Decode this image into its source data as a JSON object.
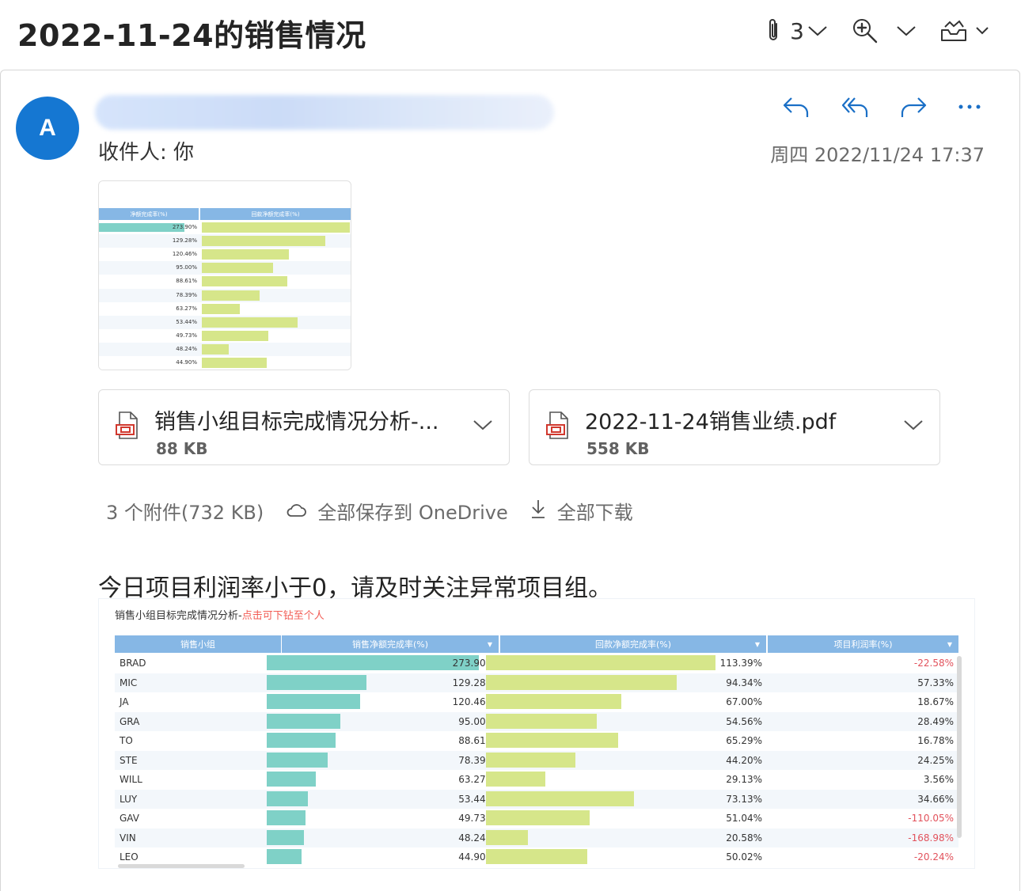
{
  "subject": "2022-11-24的销售情况",
  "top_actions": {
    "attachment_count": "3"
  },
  "message": {
    "avatar_letter": "A",
    "recipient": "收件人: 你",
    "datetime": "周四 2022/11/24 17:37",
    "body_text": "今日项目利润率小于0，请及时关注异常项目组。"
  },
  "attachments": [
    {
      "name": "销售小组目标完成情况分析-...",
      "size": "88 KB"
    },
    {
      "name": "2022-11-24销售业绩.pdf",
      "size": "558 KB"
    }
  ],
  "attachment_summary": {
    "count_label": "3 个附件(732 KB)",
    "save_label": "全部保存到 OneDrive",
    "download_label": "全部下载"
  },
  "thumbnail": {
    "headers": [
      "净额完成率(%)",
      "回款净额完成率(%)"
    ]
  },
  "colors": {
    "accent": "#1577d2",
    "bar_teal": "#7fd1c7",
    "bar_lime": "#d6e68a",
    "header_blue": "#86b7e5",
    "negative": "#e2525c"
  },
  "chart_data": {
    "type": "table",
    "title": "销售小组目标完成情况分析-",
    "title_link": "点击可下钻至个人",
    "columns": [
      "销售小组",
      "销售净额完成率(%)",
      "回款净额完成率(%)",
      "项目利润率(%)"
    ],
    "rows": [
      {
        "group": "BRAD",
        "net_sales": 273.9,
        "net_sales_label": "273.90%",
        "collection": 113.39,
        "collection_label": "113.39%",
        "margin": -22.58,
        "margin_label": "-22.58%"
      },
      {
        "group": "MIC",
        "net_sales": 129.28,
        "net_sales_label": "129.28%",
        "collection": 94.34,
        "collection_label": "94.34%",
        "margin": 57.33,
        "margin_label": "57.33%"
      },
      {
        "group": "JA",
        "net_sales": 120.46,
        "net_sales_label": "120.46%",
        "collection": 67.0,
        "collection_label": "67.00%",
        "margin": 18.67,
        "margin_label": "18.67%"
      },
      {
        "group": "GRA",
        "net_sales": 95.0,
        "net_sales_label": "95.00%",
        "collection": 54.56,
        "collection_label": "54.56%",
        "margin": 28.49,
        "margin_label": "28.49%"
      },
      {
        "group": "TO",
        "net_sales": 88.61,
        "net_sales_label": "88.61%",
        "collection": 65.29,
        "collection_label": "65.29%",
        "margin": 16.78,
        "margin_label": "16.78%"
      },
      {
        "group": "STE",
        "net_sales": 78.39,
        "net_sales_label": "78.39%",
        "collection": 44.2,
        "collection_label": "44.20%",
        "margin": 24.25,
        "margin_label": "24.25%"
      },
      {
        "group": "WILL",
        "net_sales": 63.27,
        "net_sales_label": "63.27%",
        "collection": 29.13,
        "collection_label": "29.13%",
        "margin": 3.56,
        "margin_label": "3.56%"
      },
      {
        "group": "LUY",
        "net_sales": 53.44,
        "net_sales_label": "53.44%",
        "collection": 73.13,
        "collection_label": "73.13%",
        "margin": 34.66,
        "margin_label": "34.66%"
      },
      {
        "group": "GAV",
        "net_sales": 49.73,
        "net_sales_label": "49.73%",
        "collection": 51.04,
        "collection_label": "51.04%",
        "margin": -110.05,
        "margin_label": "-110.05%"
      },
      {
        "group": "VIN",
        "net_sales": 48.24,
        "net_sales_label": "48.24%",
        "collection": 20.58,
        "collection_label": "20.58%",
        "margin": -168.98,
        "margin_label": "-168.98%"
      },
      {
        "group": "LEO",
        "net_sales": 44.9,
        "net_sales_label": "44.90%",
        "collection": 50.02,
        "collection_label": "50.02%",
        "margin": -20.24,
        "margin_label": "-20.24%"
      }
    ]
  }
}
